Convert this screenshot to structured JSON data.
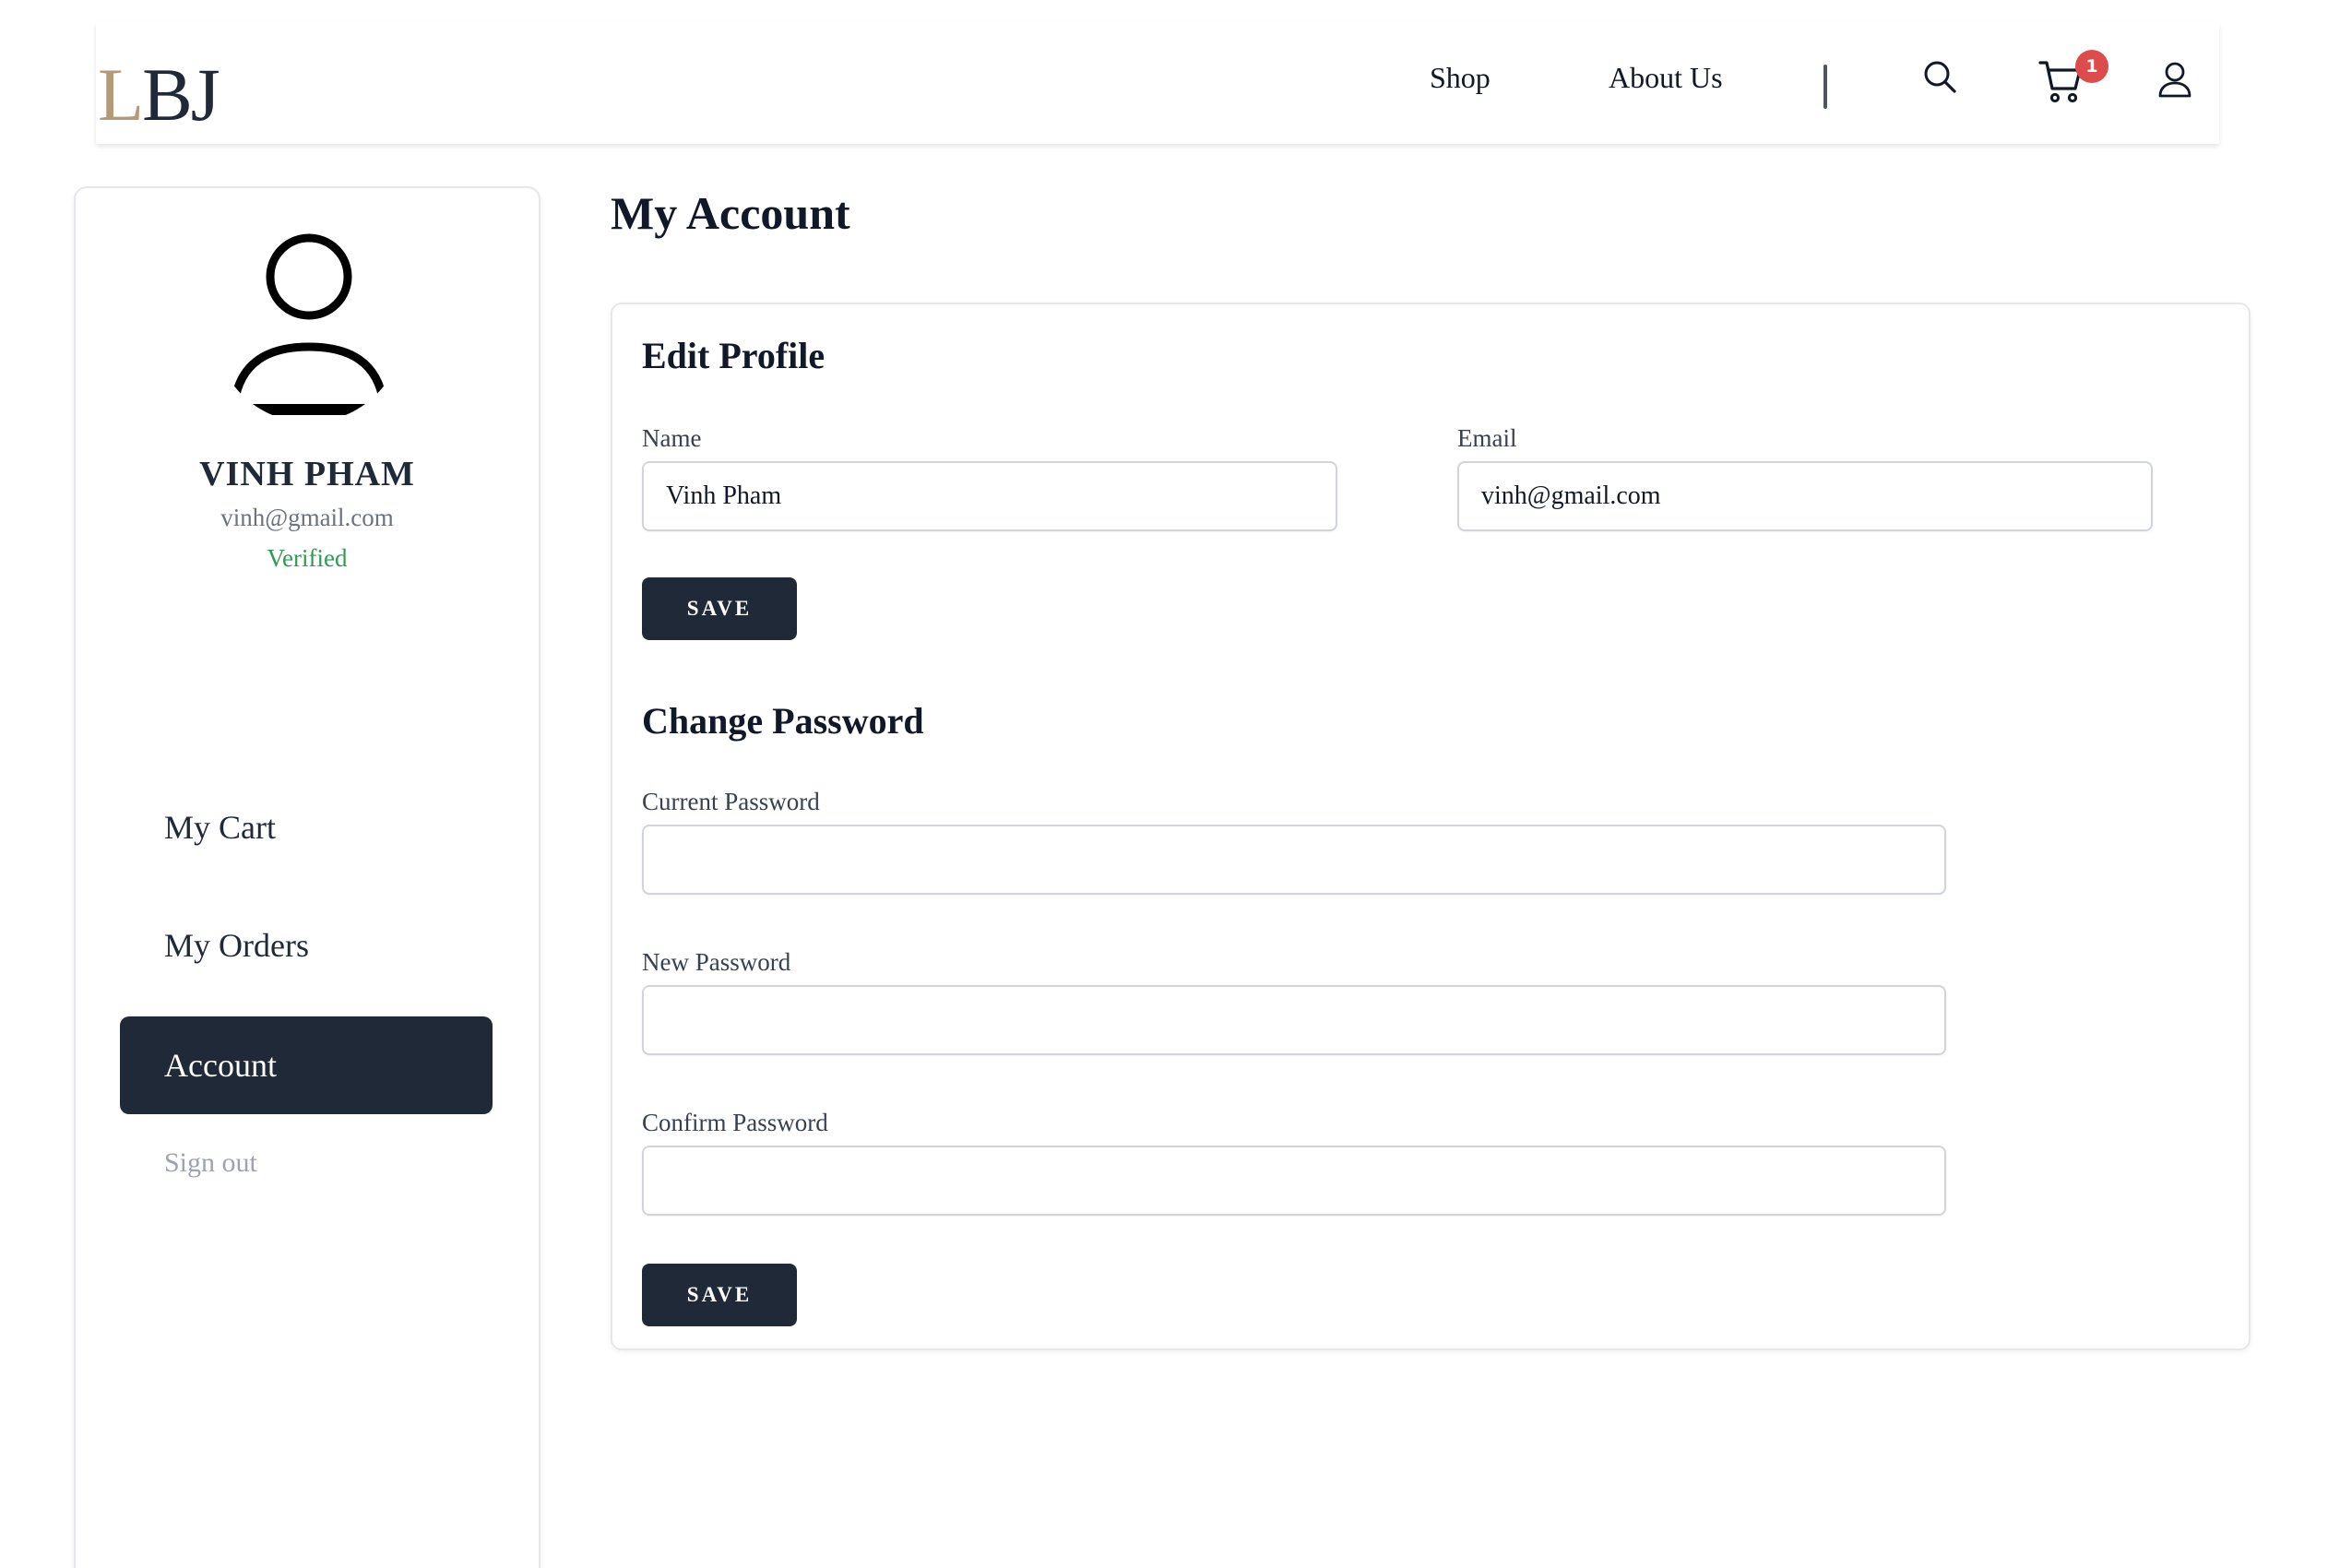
{
  "header": {
    "logo_first": "L",
    "logo_rest": "BJ",
    "nav": {
      "shop": "Shop",
      "about": "About Us"
    },
    "cart_count": "1",
    "icons": [
      "search-icon",
      "cart-icon",
      "user-icon"
    ]
  },
  "sidebar": {
    "user": {
      "name": "VINH PHAM",
      "email": "vinh@gmail.com",
      "status": "Verified"
    },
    "menu": {
      "cart": "My Cart",
      "orders": "My Orders",
      "account": "Account"
    },
    "signout": "Sign out"
  },
  "main": {
    "title": "My Account",
    "edit_profile": {
      "title": "Edit Profile",
      "name_label": "Name",
      "name_value": "Vinh Pham",
      "email_label": "Email",
      "email_value": "vinh@gmail.com",
      "save_label": "SAVE"
    },
    "change_password": {
      "title": "Change Password",
      "current_label": "Current Password",
      "new_label": "New Password",
      "confirm_label": "Confirm Password",
      "save_label": "SAVE"
    }
  },
  "colors": {
    "primary": "#1f2937",
    "logo_accent": "#b59a78",
    "verified": "#2f9b52",
    "badge": "#dc4c4c"
  }
}
